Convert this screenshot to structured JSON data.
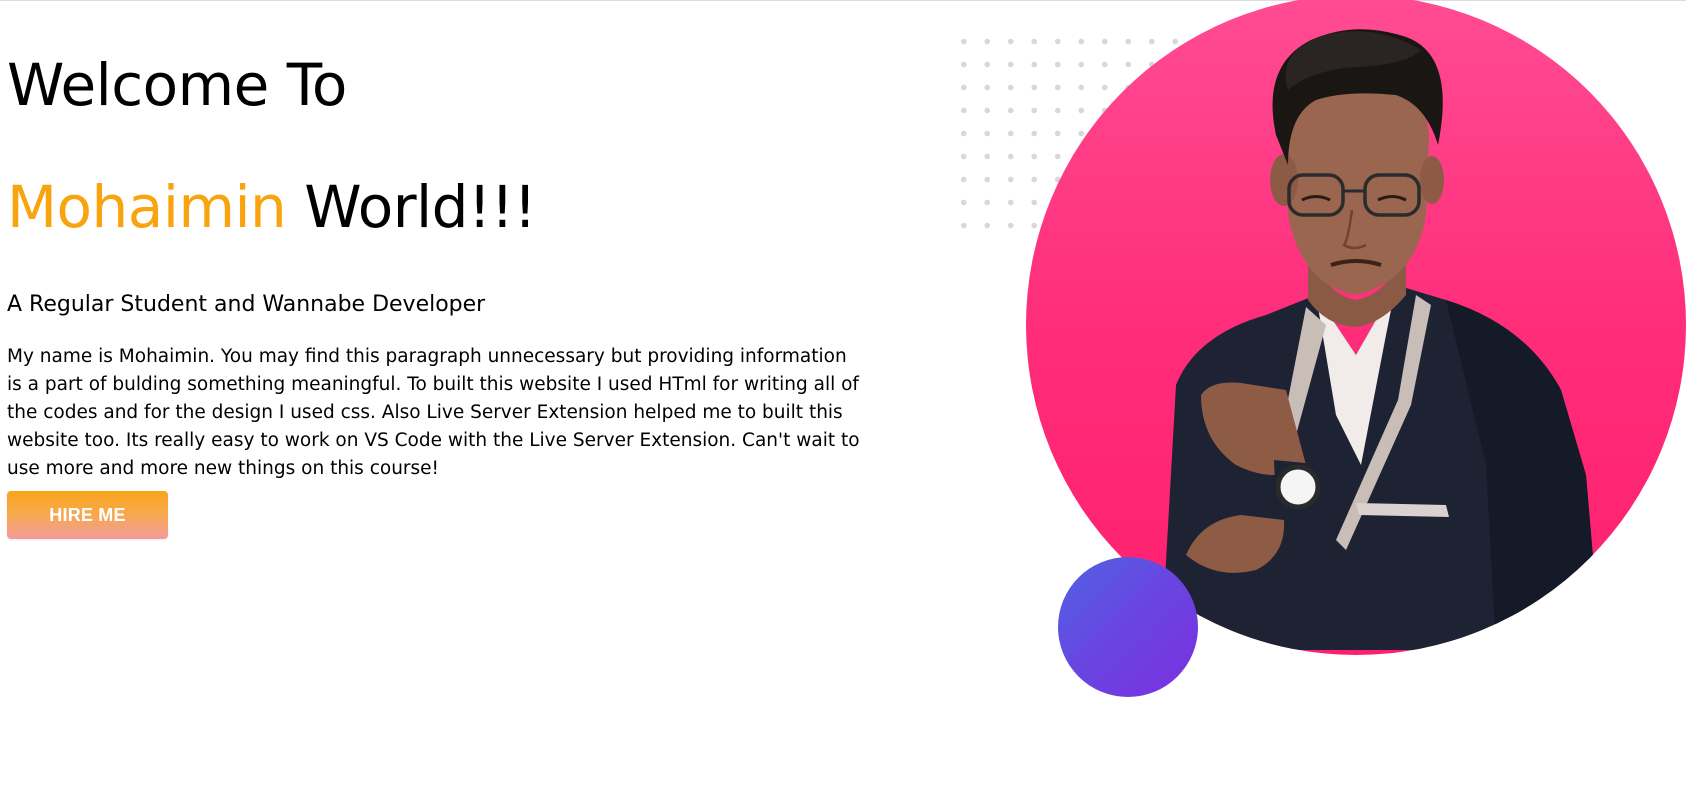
{
  "hero": {
    "title_line_1": "Welcome To",
    "title_name": "Mohaimin",
    "title_rest": " World!!!",
    "subtitle": "A Regular Student and Wannabe Developer",
    "intro": "My name is Mohaimin. You may find this paragraph unnecessary but providing information is a part of bulding something meaningful. To built this website I used HTml for writing all of the codes and for the design I used css. Also Live Server Extension helped me to built this website too. Its really easy to work on VS Code with the Live Server Extension. Can't wait to use more and more new things on this course!",
    "hire_label": "HIRE ME"
  },
  "colors": {
    "accent": "#f9a30f",
    "pink_circle": "#ff2d7a",
    "purple_circle": "#6a44e0",
    "button_top": "#fba31b",
    "button_bottom": "#f29c9c"
  },
  "art": {
    "portrait_icon": "person-portrait-icon",
    "dot_pattern_icon": "dot-grid-icon"
  }
}
